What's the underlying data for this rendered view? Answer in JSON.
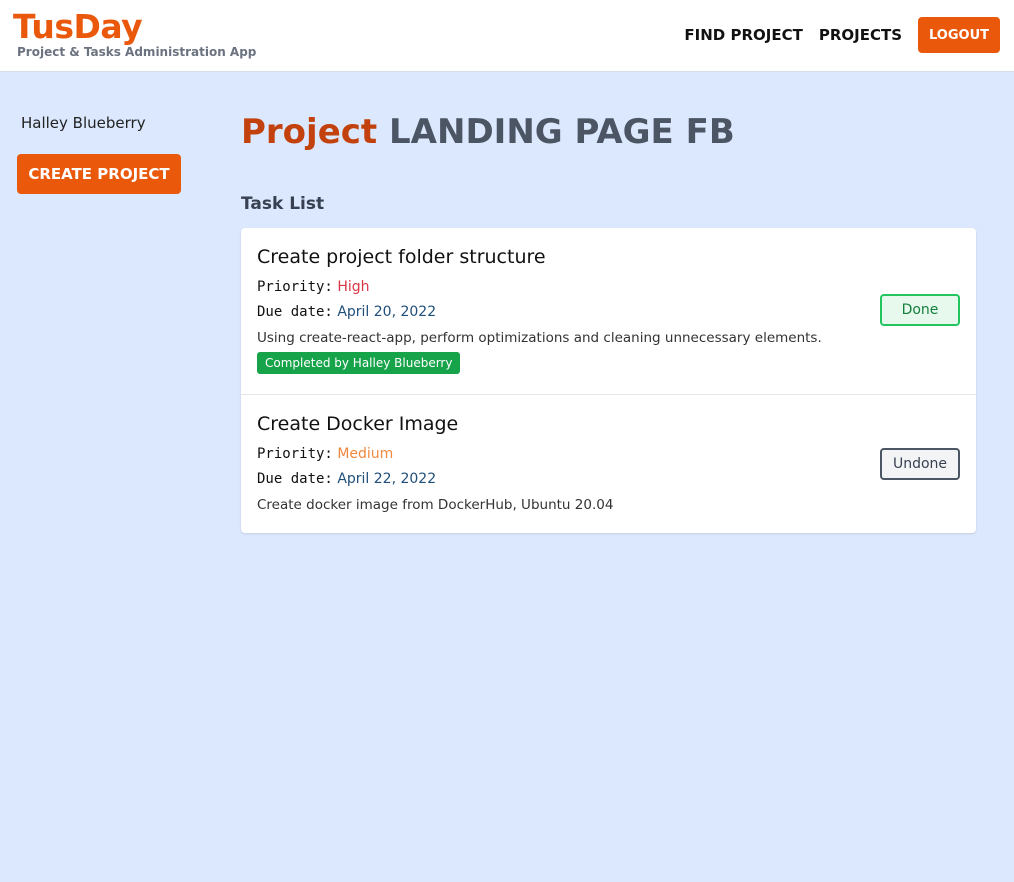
{
  "header": {
    "brand": "TusDay",
    "tagline": "Project & Tasks Administration App",
    "nav": {
      "find_project": "FIND PROJECT",
      "projects": "PROJECTS",
      "logout": "LOGOUT"
    }
  },
  "sidebar": {
    "user_name": "Halley Blueberry",
    "create_project": "CREATE PROJECT"
  },
  "main": {
    "title_prefix": "Project",
    "project_name": "LANDING PAGE FB",
    "section_title": "Task List",
    "labels": {
      "priority": "Priority:",
      "due_date": "Due date:"
    },
    "tasks": [
      {
        "title": "Create project folder structure",
        "priority": "High",
        "due_date": "April 20, 2022",
        "description": "Using create-react-app, perform optimizations and cleaning unnecessary elements.",
        "completed_by": "Completed by Halley Blueberry",
        "status_button": "Done"
      },
      {
        "title": "Create Docker Image",
        "priority": "Medium",
        "due_date": "April 22, 2022",
        "description": "Create docker image from DockerHub, Ubuntu 20.04",
        "status_button": "Undone"
      }
    ]
  },
  "colors": {
    "accent": "#ea580c",
    "background": "#dbe8fd",
    "priority_high": "#dc3545",
    "priority_medium": "#f0883e",
    "done_green": "#16a34a"
  }
}
